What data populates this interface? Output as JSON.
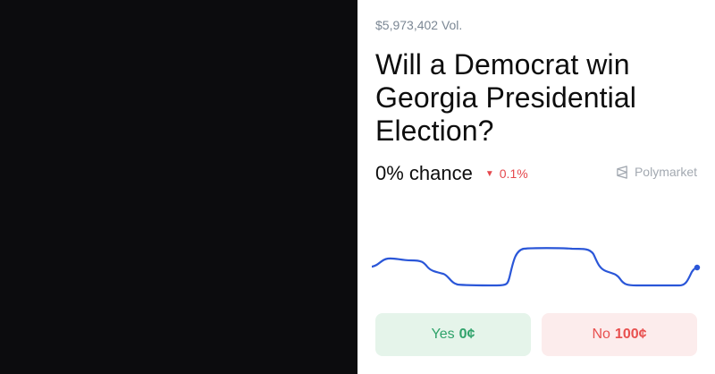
{
  "market": {
    "volume": "$5,973,402 Vol.",
    "question": "Will a Democrat win Georgia Presidential Election?",
    "chance": "0% chance",
    "change": "0.1%",
    "change_direction": "down",
    "brand": "Polymarket"
  },
  "buttons": {
    "yes_label": "Yes",
    "yes_price": "0¢",
    "no_label": "No",
    "no_price": "100¢"
  },
  "colors": {
    "line": "#2a56d8",
    "yes": "#2fa26a",
    "no": "#e8504f",
    "down": "#e5484d"
  },
  "icons": {
    "change": "down-triangle-icon",
    "brand": "polymarket-logo-icon"
  }
}
